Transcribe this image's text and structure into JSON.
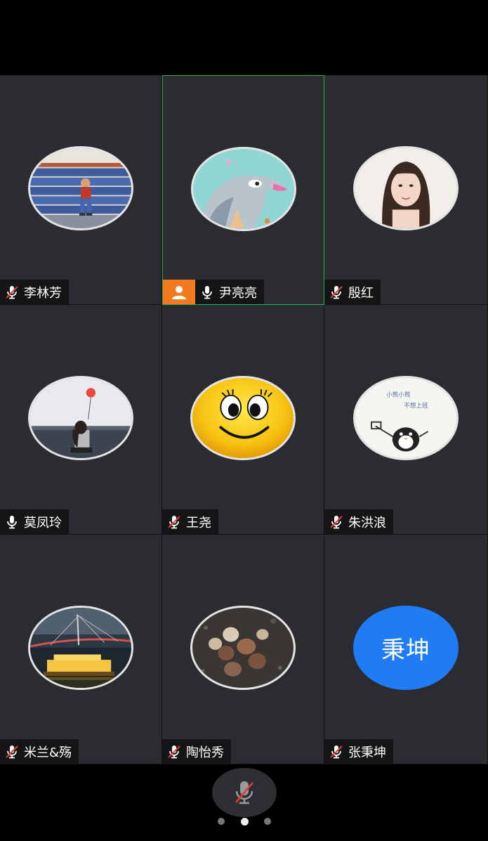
{
  "participants": [
    {
      "name": "李林芳",
      "mic": "muted",
      "avatar": "photo-boy-on-bleachers"
    },
    {
      "name": "尹亮亮",
      "mic": "on",
      "avatar": "cartoon-fish",
      "host": true,
      "active_speaker": true
    },
    {
      "name": "殷红",
      "mic": "muted",
      "avatar": "photo-woman-portrait"
    },
    {
      "name": "莫凤玲",
      "mic": "on",
      "avatar": "photo-girl-with-balloon"
    },
    {
      "name": "王尧",
      "mic": "muted",
      "avatar": "smiley-face"
    },
    {
      "name": "朱洪浪",
      "mic": "muted",
      "avatar": "cartoon-penguin-sketch",
      "avatar_caption_1": "小熊小熊",
      "avatar_caption_2": "不想上班"
    },
    {
      "name": "米兰&殇",
      "mic": "muted",
      "avatar": "photo-night-bridge-boat"
    },
    {
      "name": "陶怡秀",
      "mic": "muted",
      "avatar": "photo-chestnuts"
    },
    {
      "name": "张秉坤",
      "mic": "muted",
      "avatar": "text-avatar",
      "avatar_text": "秉坤"
    }
  ],
  "colors": {
    "tile_bg": "#2b2c2f",
    "active_border": "#21b35a",
    "host_badge": "#f47a1f",
    "muted_slash": "#e53935",
    "text_avatar_bg": "#1f7cf4"
  },
  "icons": {
    "mic_on": "mic-icon",
    "mic_muted": "mic-muted-icon",
    "host": "person-icon"
  },
  "controls": {
    "mute_button_icon": "mic-muted-icon",
    "page_count": 3,
    "current_page": 2
  }
}
